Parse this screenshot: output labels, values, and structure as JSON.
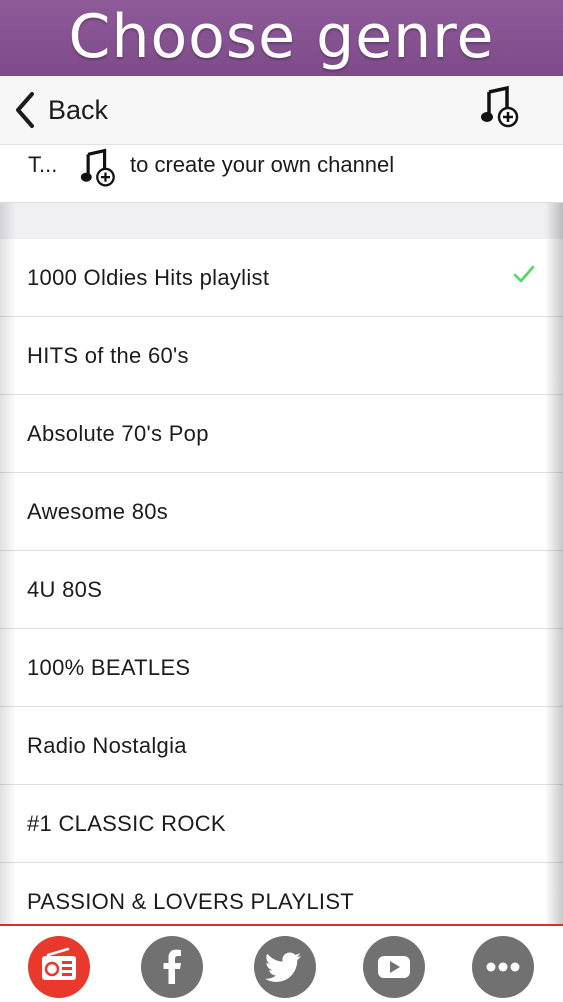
{
  "banner": {
    "title": "Choose genre"
  },
  "navbar": {
    "back_label": "Back",
    "add_icon": "music-note-plus-icon"
  },
  "hint": {
    "prefix": "T...",
    "icon": "music-note-plus-icon",
    "text": "to create your own channel"
  },
  "genres": [
    {
      "label": "1000 Oldies Hits playlist",
      "selected": true
    },
    {
      "label": "HITS of the 60's",
      "selected": false
    },
    {
      "label": "Absolute 70's Pop",
      "selected": false
    },
    {
      "label": "Awesome 80s",
      "selected": false
    },
    {
      "label": "4U 80S",
      "selected": false
    },
    {
      "label": "100% BEATLES",
      "selected": false
    },
    {
      "label": "Radio Nostalgia",
      "selected": false
    },
    {
      "label": "#1 CLASSIC ROCK",
      "selected": false
    },
    {
      "label": "PASSION & LOVERS PLAYLIST",
      "selected": false
    }
  ],
  "tabs": [
    {
      "icon": "radio-icon",
      "active": true
    },
    {
      "icon": "facebook-icon",
      "active": false
    },
    {
      "icon": "twitter-icon",
      "active": false
    },
    {
      "icon": "youtube-icon",
      "active": false
    },
    {
      "icon": "more-icon",
      "active": false
    }
  ],
  "colors": {
    "banner": "#8e5a98",
    "accent": "#e8392c",
    "check": "#4cd964",
    "tab_icon_bg": "#717171"
  }
}
